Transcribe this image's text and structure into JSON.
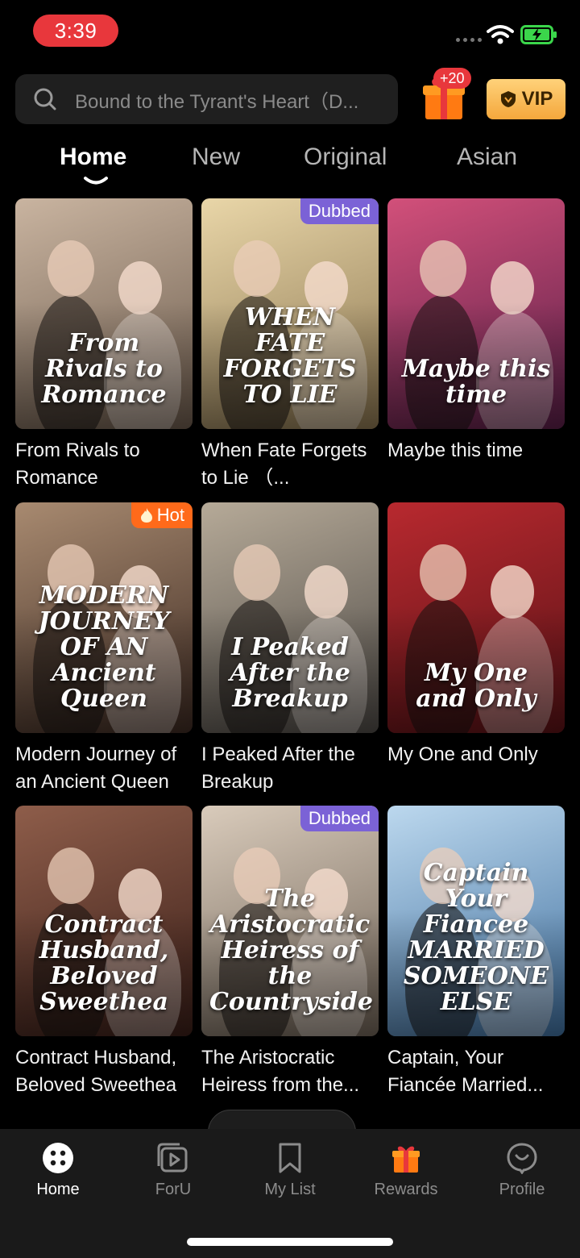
{
  "status_bar": {
    "time": "3:39"
  },
  "search": {
    "placeholder": "Bound to the Tyrant's Heart（D..."
  },
  "header": {
    "gift_badge": "+20",
    "vip_label": "VIP"
  },
  "tabs": [
    {
      "label": "Home",
      "active": true
    },
    {
      "label": "New",
      "active": false
    },
    {
      "label": "Original",
      "active": false
    },
    {
      "label": "Asian",
      "active": false
    }
  ],
  "dramas": [
    {
      "title": "From Rivals to Romance",
      "poster_text": "From Rivals to Romance",
      "tag": "",
      "colors": [
        "#6b5a4c",
        "#c9b4a0"
      ]
    },
    {
      "title": "When Fate Forgets to Lie （...",
      "poster_text": "WHEN FATE FORGETS TO LIE",
      "tag": "Dubbed",
      "colors": [
        "#8a7550",
        "#e9d6a8"
      ]
    },
    {
      "title": "Maybe this time",
      "poster_text": "Maybe this time",
      "tag": "",
      "colors": [
        "#5a1f48",
        "#d2507a"
      ]
    },
    {
      "title": "Modern Journey of an Ancient Queen",
      "poster_text": "MODERN JOURNEY OF AN Ancient Queen",
      "tag": "Hot",
      "colors": [
        "#3d2a22",
        "#a88a70"
      ]
    },
    {
      "title": "I Peaked After the Breakup",
      "poster_text": "I Peaked After the Breakup",
      "tag": "",
      "colors": [
        "#4e4a46",
        "#b6aa98"
      ]
    },
    {
      "title": "My One and Only",
      "poster_text": "My One and Only",
      "tag": "",
      "colors": [
        "#5a1216",
        "#b8292f"
      ]
    },
    {
      "title": "Contract Husband, Beloved Sweethea",
      "poster_text": "Contract Husband, Beloved Sweethea",
      "tag": "",
      "colors": [
        "#3a1e18",
        "#8e5d4a"
      ]
    },
    {
      "title": "The Aristocratic Heiress from the...",
      "poster_text": "The Aristocratic Heiress of the Countryside",
      "tag": "Dubbed",
      "colors": [
        "#6e6256",
        "#d9cbbb"
      ]
    },
    {
      "title": "Captain, Your Fiancée Married...",
      "poster_text": "Captain Your Fiancee MARRIED SOMEONE ELSE",
      "tag": "",
      "colors": [
        "#3f6f9e",
        "#bcd8ee"
      ]
    }
  ],
  "bottom_nav": [
    {
      "label": "Home",
      "icon": "home-icon",
      "active": true
    },
    {
      "label": "ForU",
      "icon": "foru-icon",
      "active": false
    },
    {
      "label": "My List",
      "icon": "bookmark-icon",
      "active": false
    },
    {
      "label": "Rewards",
      "icon": "gift-icon",
      "active": false
    },
    {
      "label": "Profile",
      "icon": "profile-icon",
      "active": false
    }
  ],
  "colors": {
    "accent": "#e8373c",
    "vip": "#f4a73c",
    "dubbed": "#7b62d6",
    "hot": "#ff6a1a"
  }
}
